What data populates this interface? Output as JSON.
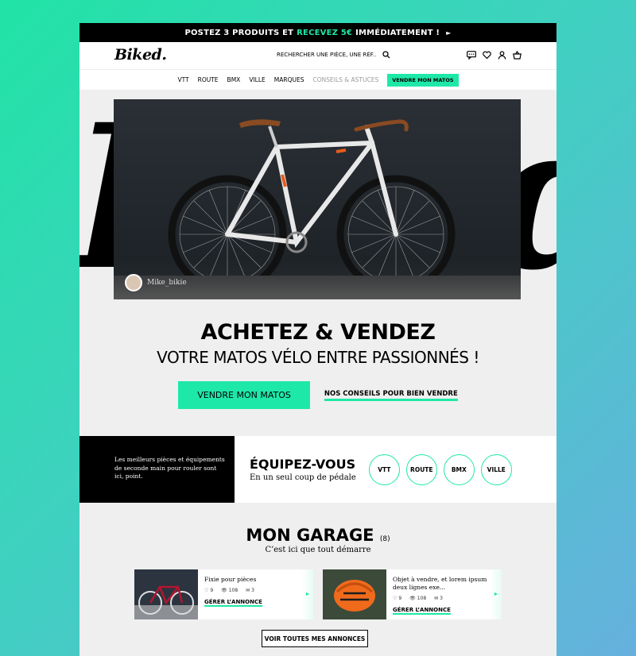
{
  "promo": {
    "text": "POSTEZ 3 PRODUITS ET",
    "accent": "RECEVEZ 5€",
    "suffix": "IMMÉDIATEMENT !",
    "arrow": "►"
  },
  "header": {
    "logo": "Biked.",
    "search_placeholder": "RECHERCHER UNE PIÈCE, UNE RÉF..",
    "icons": [
      "message-icon",
      "heart-icon",
      "user-icon",
      "basket-icon"
    ]
  },
  "nav": {
    "items": [
      "VTT",
      "ROUTE",
      "BMX",
      "VILLE",
      "MARQUES"
    ],
    "muted": "CONSEILS & ASTUCES",
    "cta": "VENDRE MON MATOS"
  },
  "hero": {
    "photo_credit": "Mike_bikie",
    "title": "ACHETEZ & VENDEZ",
    "subtitle": "VOTRE MATOS VÉLO ENTRE PASSIONNÉS !",
    "primary_cta": "VENDRE MON MATOS",
    "secondary_cta": "NOS CONSEILS POUR BIEN VENDRE"
  },
  "equip": {
    "intro": "Les meilleurs pièces et équipements de seconde main pour rouler sont ici, point.",
    "title": "ÉQUIPEZ-VOUS",
    "subtitle": "En un seul coup de pédale",
    "categories": [
      "VTT",
      "ROUTE",
      "BMX",
      "VILLE"
    ]
  },
  "garage": {
    "title": "MON GARAGE",
    "count": "(8)",
    "subtitle": "C’est ici que tout démarre",
    "listings": [
      {
        "title": "Fixie pour pièces",
        "likes": "9",
        "views": "108",
        "messages": "3",
        "action": "GÉRER L’ANNONCE"
      },
      {
        "title": "Objet à vendre, et lorem ipsum deux lignes exe...",
        "likes": "9",
        "views": "108",
        "messages": "3",
        "action": "GÉRER L’ANNONCE"
      }
    ],
    "see_all": "VOIR TOUTES MES ANNONCES"
  },
  "colors": {
    "accent": "#1ee8a8",
    "dark": "#000000",
    "panel": "#efefef"
  }
}
